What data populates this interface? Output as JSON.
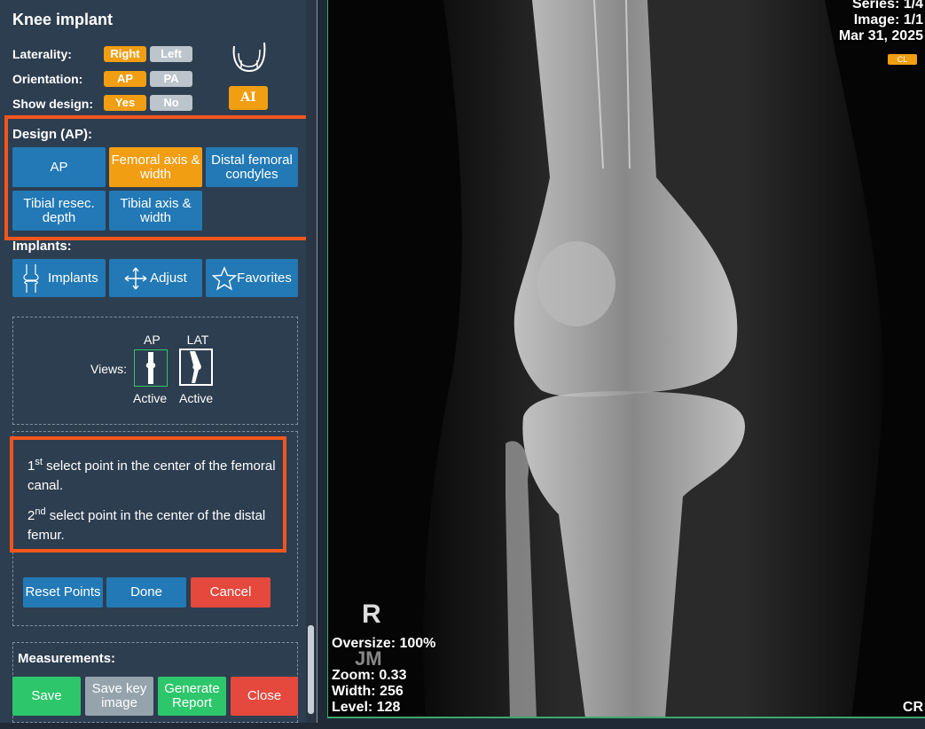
{
  "panel": {
    "title": "Knee implant",
    "laterality": {
      "label": "Laterality:",
      "options": [
        "Right",
        "Left"
      ],
      "selected": "Right"
    },
    "orientation": {
      "label": "Orientation:",
      "options": [
        "AP",
        "PA"
      ],
      "selected": "AP"
    },
    "show_design": {
      "label": "Show design:",
      "options": [
        "Yes",
        "No"
      ],
      "selected": "Yes"
    },
    "ai_label": "AI",
    "design": {
      "heading": "Design (AP):",
      "buttons": [
        "AP",
        "Femoral axis & width",
        "Distal femoral condyles",
        "Tibial resec. depth",
        "Tibial axis & width"
      ],
      "active": "Femoral axis & width"
    },
    "implants": {
      "heading": "Implants:",
      "buttons": [
        "Implants",
        "Adjust",
        "Favorites"
      ]
    },
    "views": {
      "label": "Views:",
      "ap_label": "AP",
      "lat_label": "LAT",
      "ap_status": "Active",
      "lat_status": "Active"
    },
    "instructions": {
      "step1_ord": "1",
      "step1_sup": "st",
      "step1_text": " select point in the center of the femoral canal.",
      "step2_ord": "2",
      "step2_sup": "nd",
      "step2_text": " select point in the center of the distal femur."
    },
    "actions": {
      "reset": "Reset Points",
      "done": "Done",
      "cancel": "Cancel"
    },
    "measurements": {
      "heading": "Measurements:",
      "save": "Save",
      "save_key": "Save key image",
      "report": "Generate Report",
      "close": "Close"
    }
  },
  "viewer": {
    "series": "Series: 1/4",
    "image": "Image: 1/1",
    "date": "Mar 31, 2025",
    "cl_badge": "CL",
    "marker_r": "R",
    "marker_initials": "JM",
    "oversize": "Oversize: 100%",
    "zoom": "Zoom: 0.33",
    "width": "Width: 256",
    "level": "Level: 128",
    "corner": "CR"
  },
  "colors": {
    "panel_bg": "#2d3e50",
    "primary": "#2279b5",
    "accent": "#f19e12",
    "highlight_box": "#f2561d",
    "save": "#2ec66b",
    "close": "#e5483d"
  }
}
